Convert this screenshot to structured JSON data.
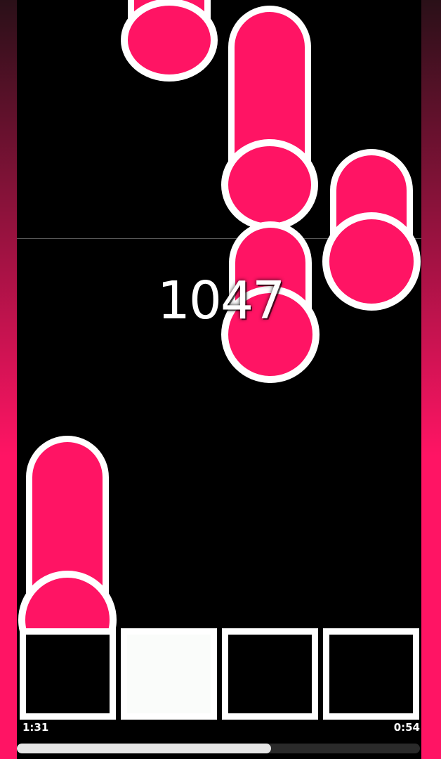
{
  "score": "1047",
  "time_elapsed": "1:31",
  "time_remaining": "0:54",
  "progress_fraction": 0.63,
  "colors": {
    "note_fill": "#ff1464",
    "note_outline": "#ffffff",
    "background": "#000000",
    "side_gradient_top": "#2a1018",
    "side_gradient_bottom": "#ff1464",
    "lane_key_active": "#fafcfa"
  },
  "lanes": [
    {
      "key": "lane-1",
      "pressed": false
    },
    {
      "key": "lane-2",
      "pressed": true
    },
    {
      "key": "lane-3",
      "pressed": false
    },
    {
      "key": "lane-4",
      "pressed": false
    }
  ]
}
